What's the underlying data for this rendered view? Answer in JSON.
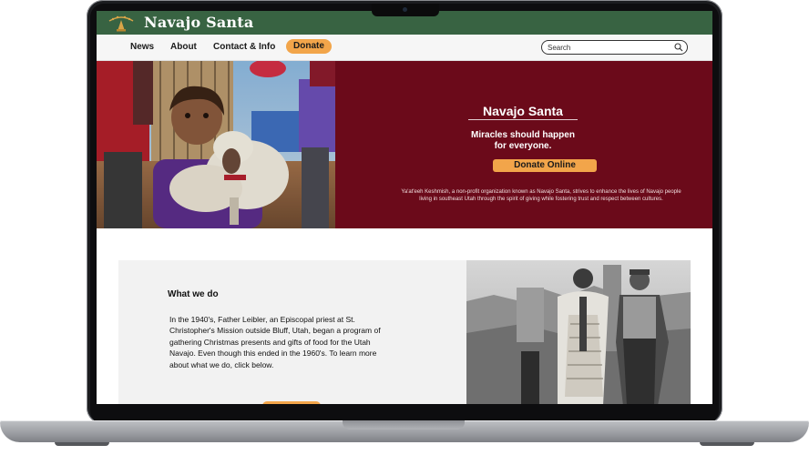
{
  "site": {
    "brand_name": "Navajo Santa"
  },
  "nav": {
    "items": [
      {
        "label": "News"
      },
      {
        "label": "About"
      },
      {
        "label": "Contact & Info"
      }
    ],
    "donate_label": "Donate",
    "search_placeholder": "Search"
  },
  "hero": {
    "title": "Navajo Santa",
    "tagline": "Miracles should happen for everyone.",
    "button_label": "Donate Online",
    "description": "Ya'at'eeh Keshmish, a non-profit organization known as Navajo Santa, strives to enhance the lives of Navajo people living in southeast Utah through the spirit of giving while fostering trust and respect between cultures."
  },
  "about": {
    "heading": "What we do",
    "body": "In the 1940's, Father Leibler, an Episcopal priest at St. Christopher's Mission outside Bluff, Utah, began a program of gathering Christmas presents and gifts of food for the Utah Navajo. Even though this ended in the 1960's. To learn more about what we do, click below."
  },
  "colors": {
    "brand_green": "#386342",
    "hero_maroon": "#6b0a1a",
    "accent_orange": "#f2a54a"
  },
  "icons": {
    "logo": "navajo-santa-logo-icon",
    "search": "search-icon"
  }
}
